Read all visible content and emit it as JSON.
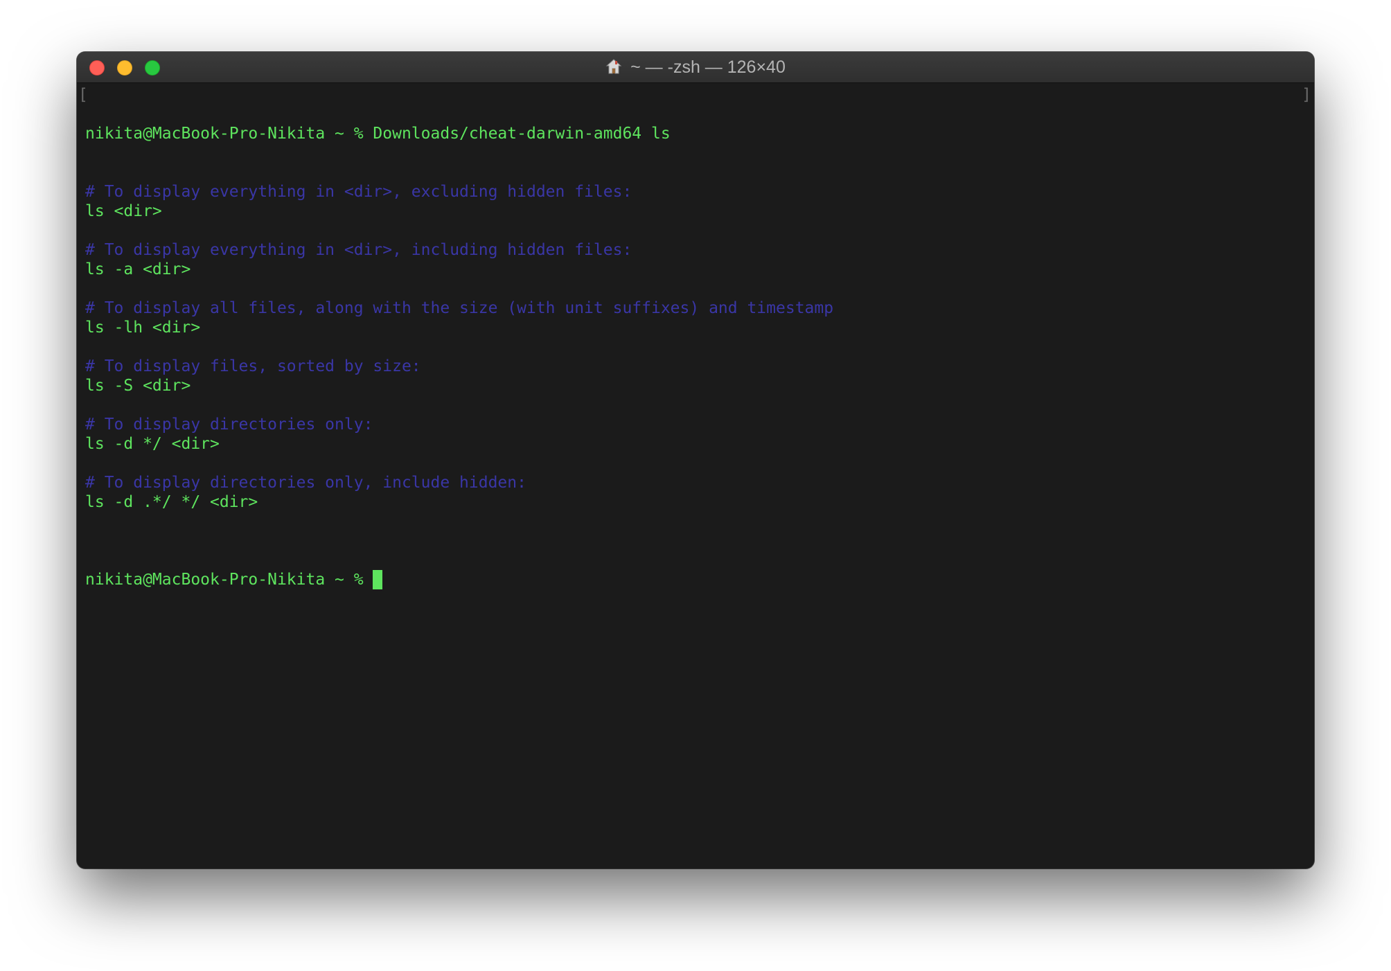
{
  "window": {
    "title": "~ — -zsh — 126×40",
    "buttons": {
      "close": "close",
      "minimize": "minimize",
      "zoom": "zoom"
    },
    "colors": {
      "background": "#1b1b1b",
      "text": "#5ee45e",
      "comment": "#3a36a6"
    }
  },
  "terminal": {
    "bracket_left": "[",
    "bracket_right": "]",
    "command_prompt": "nikita@MacBook-Pro-Nikita ~ % ",
    "command": "Downloads/cheat-darwin-amd64 ls",
    "lines": [
      {
        "kind": "comment",
        "text": "# To display everything in <dir>, excluding hidden files:"
      },
      {
        "kind": "output",
        "text": "ls <dir>"
      },
      {
        "kind": "blank",
        "text": ""
      },
      {
        "kind": "comment",
        "text": "# To display everything in <dir>, including hidden files:"
      },
      {
        "kind": "output",
        "text": "ls -a <dir>"
      },
      {
        "kind": "blank",
        "text": ""
      },
      {
        "kind": "comment",
        "text": "# To display all files, along with the size (with unit suffixes) and timestamp"
      },
      {
        "kind": "output",
        "text": "ls -lh <dir>"
      },
      {
        "kind": "blank",
        "text": ""
      },
      {
        "kind": "comment",
        "text": "# To display files, sorted by size:"
      },
      {
        "kind": "output",
        "text": "ls -S <dir>"
      },
      {
        "kind": "blank",
        "text": ""
      },
      {
        "kind": "comment",
        "text": "# To display directories only:"
      },
      {
        "kind": "output",
        "text": "ls -d */ <dir>"
      },
      {
        "kind": "blank",
        "text": ""
      },
      {
        "kind": "comment",
        "text": "# To display directories only, include hidden:"
      },
      {
        "kind": "output",
        "text": "ls -d .*/ */ <dir>"
      },
      {
        "kind": "blank",
        "text": ""
      }
    ],
    "current_prompt": "nikita@MacBook-Pro-Nikita ~ % "
  }
}
